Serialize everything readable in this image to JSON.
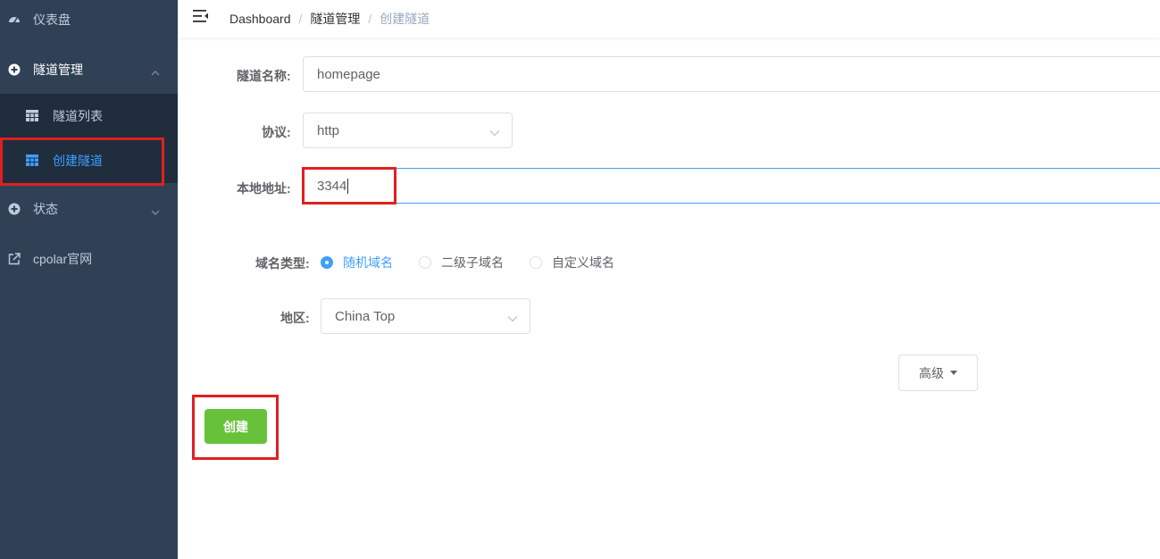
{
  "sidebar": {
    "dashboard": "仪表盘",
    "tunnel_mgmt": "隧道管理",
    "tunnel_list": "隧道列表",
    "create_tunnel": "创建隧道",
    "status": "状态",
    "cpolar_site": "cpolar官网"
  },
  "header": {
    "breadcrumb": [
      "Dashboard",
      "隧道管理",
      "创建隧道"
    ],
    "separator": "/"
  },
  "form": {
    "name_label": "隧道名称:",
    "name_value": "homepage",
    "protocol_label": "协议:",
    "protocol_value": "http",
    "local_addr_label": "本地地址:",
    "local_addr_value": "3344",
    "domain_type_label": "域名类型:",
    "domain_options": [
      "随机域名",
      "二级子域名",
      "自定义域名"
    ],
    "domain_selected": "随机域名",
    "region_label": "地区:",
    "region_value": "China Top",
    "advanced_label": "高级",
    "create_label": "创建"
  },
  "colors": {
    "sidebar_bg": "#304156",
    "submenu_bg": "#1f2d3d",
    "accent": "#409eff",
    "create_button": "#67c23a",
    "highlight_box": "#e02020"
  }
}
